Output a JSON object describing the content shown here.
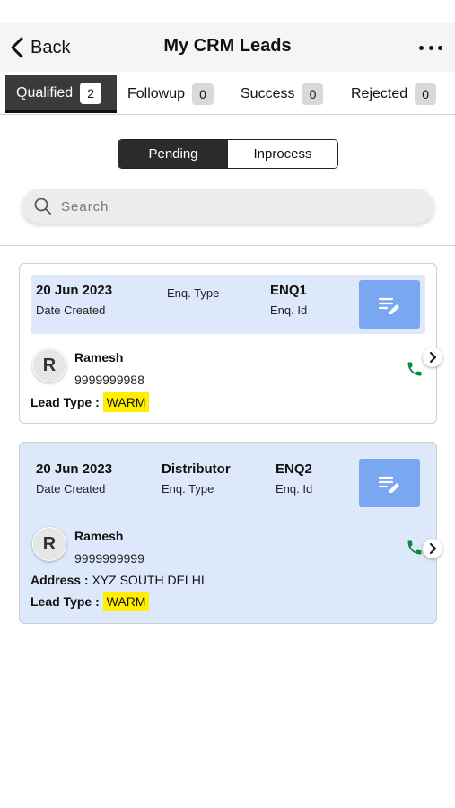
{
  "header": {
    "back_label": "Back",
    "title": "My CRM Leads"
  },
  "tabs": [
    {
      "label": "Qualified",
      "count": "2"
    },
    {
      "label": "Followup",
      "count": "0"
    },
    {
      "label": "Success",
      "count": "0"
    },
    {
      "label": "Rejected",
      "count": "0"
    }
  ],
  "segment": {
    "pending": "Pending",
    "inprocess": "Inprocess"
  },
  "search": {
    "placeholder": "Search"
  },
  "leads": [
    {
      "date": "20 Jun 2023",
      "date_label": "Date Created",
      "enq_type_label": "Enq. Type",
      "enq_id": "ENQ1",
      "enq_id_label": "Enq. Id",
      "initial": "R",
      "name": "Ramesh",
      "phone": "9999999988",
      "lead_type_label": "Lead Type :",
      "lead_type": "WARM"
    },
    {
      "date": "20 Jun 2023",
      "date_label": "Date Created",
      "enq_type": "Distributor",
      "enq_type_label": "Enq. Type",
      "enq_id": "ENQ2",
      "enq_id_label": "Enq. Id",
      "initial": "R",
      "name": "Ramesh",
      "phone": "9999999999",
      "address_label": "Address :",
      "address": "XYZ SOUTH DELHI",
      "lead_type_label": "Lead Type :",
      "lead_type": "WARM"
    }
  ],
  "colors": {
    "accent": "#79a7f2",
    "card_highlight": "#dde9fb",
    "warm_badge": "#ffee00",
    "call_green": "#0a8a3a"
  },
  "icons": {
    "back": "chevron-left-icon",
    "more": "more-dots-icon",
    "search": "search-icon",
    "edit": "edit-note-icon",
    "call": "phone-icon",
    "open": "chevron-right-icon"
  }
}
